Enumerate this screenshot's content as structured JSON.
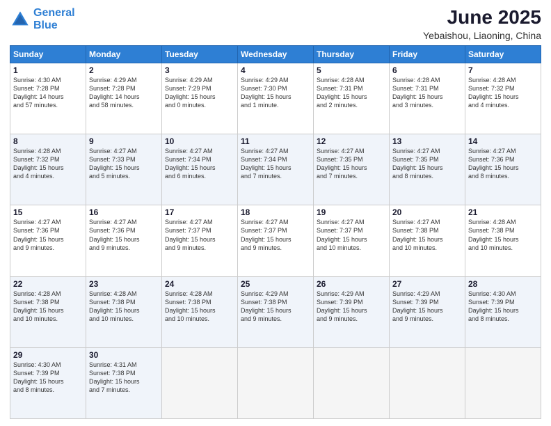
{
  "logo": {
    "line1": "General",
    "line2": "Blue"
  },
  "title": "June 2025",
  "subtitle": "Yebaishou, Liaoning, China",
  "weekdays": [
    "Sunday",
    "Monday",
    "Tuesday",
    "Wednesday",
    "Thursday",
    "Friday",
    "Saturday"
  ],
  "weeks": [
    [
      {
        "day": "1",
        "info": "Sunrise: 4:30 AM\nSunset: 7:28 PM\nDaylight: 14 hours\nand 57 minutes."
      },
      {
        "day": "2",
        "info": "Sunrise: 4:29 AM\nSunset: 7:28 PM\nDaylight: 14 hours\nand 58 minutes."
      },
      {
        "day": "3",
        "info": "Sunrise: 4:29 AM\nSunset: 7:29 PM\nDaylight: 15 hours\nand 0 minutes."
      },
      {
        "day": "4",
        "info": "Sunrise: 4:29 AM\nSunset: 7:30 PM\nDaylight: 15 hours\nand 1 minute."
      },
      {
        "day": "5",
        "info": "Sunrise: 4:28 AM\nSunset: 7:31 PM\nDaylight: 15 hours\nand 2 minutes."
      },
      {
        "day": "6",
        "info": "Sunrise: 4:28 AM\nSunset: 7:31 PM\nDaylight: 15 hours\nand 3 minutes."
      },
      {
        "day": "7",
        "info": "Sunrise: 4:28 AM\nSunset: 7:32 PM\nDaylight: 15 hours\nand 4 minutes."
      }
    ],
    [
      {
        "day": "8",
        "info": "Sunrise: 4:28 AM\nSunset: 7:32 PM\nDaylight: 15 hours\nand 4 minutes."
      },
      {
        "day": "9",
        "info": "Sunrise: 4:27 AM\nSunset: 7:33 PM\nDaylight: 15 hours\nand 5 minutes."
      },
      {
        "day": "10",
        "info": "Sunrise: 4:27 AM\nSunset: 7:34 PM\nDaylight: 15 hours\nand 6 minutes."
      },
      {
        "day": "11",
        "info": "Sunrise: 4:27 AM\nSunset: 7:34 PM\nDaylight: 15 hours\nand 7 minutes."
      },
      {
        "day": "12",
        "info": "Sunrise: 4:27 AM\nSunset: 7:35 PM\nDaylight: 15 hours\nand 7 minutes."
      },
      {
        "day": "13",
        "info": "Sunrise: 4:27 AM\nSunset: 7:35 PM\nDaylight: 15 hours\nand 8 minutes."
      },
      {
        "day": "14",
        "info": "Sunrise: 4:27 AM\nSunset: 7:36 PM\nDaylight: 15 hours\nand 8 minutes."
      }
    ],
    [
      {
        "day": "15",
        "info": "Sunrise: 4:27 AM\nSunset: 7:36 PM\nDaylight: 15 hours\nand 9 minutes."
      },
      {
        "day": "16",
        "info": "Sunrise: 4:27 AM\nSunset: 7:36 PM\nDaylight: 15 hours\nand 9 minutes."
      },
      {
        "day": "17",
        "info": "Sunrise: 4:27 AM\nSunset: 7:37 PM\nDaylight: 15 hours\nand 9 minutes."
      },
      {
        "day": "18",
        "info": "Sunrise: 4:27 AM\nSunset: 7:37 PM\nDaylight: 15 hours\nand 9 minutes."
      },
      {
        "day": "19",
        "info": "Sunrise: 4:27 AM\nSunset: 7:37 PM\nDaylight: 15 hours\nand 10 minutes."
      },
      {
        "day": "20",
        "info": "Sunrise: 4:27 AM\nSunset: 7:38 PM\nDaylight: 15 hours\nand 10 minutes."
      },
      {
        "day": "21",
        "info": "Sunrise: 4:28 AM\nSunset: 7:38 PM\nDaylight: 15 hours\nand 10 minutes."
      }
    ],
    [
      {
        "day": "22",
        "info": "Sunrise: 4:28 AM\nSunset: 7:38 PM\nDaylight: 15 hours\nand 10 minutes."
      },
      {
        "day": "23",
        "info": "Sunrise: 4:28 AM\nSunset: 7:38 PM\nDaylight: 15 hours\nand 10 minutes."
      },
      {
        "day": "24",
        "info": "Sunrise: 4:28 AM\nSunset: 7:38 PM\nDaylight: 15 hours\nand 10 minutes."
      },
      {
        "day": "25",
        "info": "Sunrise: 4:29 AM\nSunset: 7:38 PM\nDaylight: 15 hours\nand 9 minutes."
      },
      {
        "day": "26",
        "info": "Sunrise: 4:29 AM\nSunset: 7:39 PM\nDaylight: 15 hours\nand 9 minutes."
      },
      {
        "day": "27",
        "info": "Sunrise: 4:29 AM\nSunset: 7:39 PM\nDaylight: 15 hours\nand 9 minutes."
      },
      {
        "day": "28",
        "info": "Sunrise: 4:30 AM\nSunset: 7:39 PM\nDaylight: 15 hours\nand 8 minutes."
      }
    ],
    [
      {
        "day": "29",
        "info": "Sunrise: 4:30 AM\nSunset: 7:39 PM\nDaylight: 15 hours\nand 8 minutes."
      },
      {
        "day": "30",
        "info": "Sunrise: 4:31 AM\nSunset: 7:38 PM\nDaylight: 15 hours\nand 7 minutes."
      },
      {
        "day": "",
        "info": ""
      },
      {
        "day": "",
        "info": ""
      },
      {
        "day": "",
        "info": ""
      },
      {
        "day": "",
        "info": ""
      },
      {
        "day": "",
        "info": ""
      }
    ]
  ]
}
